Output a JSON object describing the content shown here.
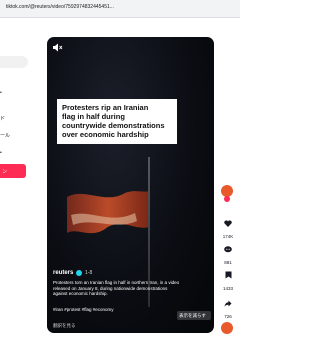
{
  "browser": {
    "url": "tiktok.com/@reuters/video/7592974832445451..."
  },
  "sidebar": {
    "items": [
      {
        "label": "ド"
      },
      {
        "label": "ール"
      },
      {
        "label": "ン"
      }
    ]
  },
  "video": {
    "headline_lines": [
      "Protesters rip an Iranian",
      "flag in half during",
      "countrywide demonstrations",
      "over economic hardship"
    ],
    "author": "reuters",
    "date": "1-8",
    "caption": "Protesters torn an Iranian flag in half in northern Iran, in a video released on January 8, during nationwide demonstrations against economic hardship.",
    "hashtags": "#iran #protest #flag #economy",
    "translate": "翻訳を見る",
    "hide_label": "表示を減らす"
  },
  "actions": {
    "likes": "174K",
    "comments": "881",
    "saves": "1433",
    "shares": "726"
  },
  "colors": {
    "accent": "#fe2c55",
    "avatar": "#e8592b"
  }
}
